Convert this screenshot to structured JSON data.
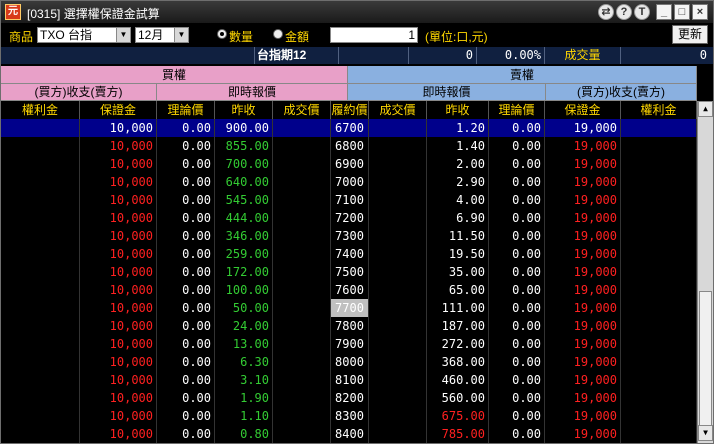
{
  "window": {
    "title": "[0315] 選擇權保證金試算",
    "icon_glyph": "元",
    "buttons": [
      "⇄",
      "?",
      "T",
      "_",
      "□",
      "×"
    ]
  },
  "toolbar": {
    "product_label": "商品",
    "product_value": "TXO 台指",
    "month_value": "12月",
    "radio_qty_label": "數量",
    "radio_amount_label": "金額",
    "quantity_value": "1",
    "unit_label": "(單位:口,元)",
    "refresh_label": "更新"
  },
  "info": {
    "name": "台指期12",
    "field1": "",
    "field2": "0",
    "change_pct": "0.00%",
    "volume_label": "成交量",
    "volume_value": "0"
  },
  "headers": {
    "call_group": "買權",
    "put_group": "賣權",
    "call_sub_left": "(買方)收支(賣方)",
    "call_sub_right": "即時報價",
    "put_sub_left": "即時報價",
    "put_sub_right": "(買方)收支(賣方)",
    "columns": [
      "權利金",
      "保證金",
      "理論價",
      "昨收",
      "成交價",
      "履約價",
      "成交價",
      "昨收",
      "理論價",
      "保證金",
      "權利金"
    ]
  },
  "colors": {
    "selected_row_bg": "#00008b",
    "atm_strike_bg": "#c0c0c0",
    "call_margin": "#ff2020",
    "call_prev_close": "#33cc33",
    "put_margin": "#ff2020",
    "white": "#ffffff",
    "yellow": "#ffd700",
    "red": "#ff2020"
  },
  "rows": [
    {
      "call_premium": "",
      "call_margin": "10,000",
      "call_theo": "0.00",
      "call_prev": "900.00",
      "call_last": "",
      "strike": "6700",
      "put_last": "",
      "put_prev": "1.20",
      "put_theo": "0.00",
      "put_margin": "19,000",
      "put_premium": "",
      "selected": true,
      "put_prev_color": "white"
    },
    {
      "call_premium": "",
      "call_margin": "10,000",
      "call_theo": "0.00",
      "call_prev": "855.00",
      "call_last": "",
      "strike": "6800",
      "put_last": "",
      "put_prev": "1.40",
      "put_theo": "0.00",
      "put_margin": "19,000",
      "put_premium": "",
      "put_prev_color": "white"
    },
    {
      "call_premium": "",
      "call_margin": "10,000",
      "call_theo": "0.00",
      "call_prev": "700.00",
      "call_last": "",
      "strike": "6900",
      "put_last": "",
      "put_prev": "2.00",
      "put_theo": "0.00",
      "put_margin": "19,000",
      "put_premium": "",
      "put_prev_color": "white"
    },
    {
      "call_premium": "",
      "call_margin": "10,000",
      "call_theo": "0.00",
      "call_prev": "640.00",
      "call_last": "",
      "strike": "7000",
      "put_last": "",
      "put_prev": "2.90",
      "put_theo": "0.00",
      "put_margin": "19,000",
      "put_premium": "",
      "put_prev_color": "white"
    },
    {
      "call_premium": "",
      "call_margin": "10,000",
      "call_theo": "0.00",
      "call_prev": "545.00",
      "call_last": "",
      "strike": "7100",
      "put_last": "",
      "put_prev": "4.00",
      "put_theo": "0.00",
      "put_margin": "19,000",
      "put_premium": "",
      "put_prev_color": "white"
    },
    {
      "call_premium": "",
      "call_margin": "10,000",
      "call_theo": "0.00",
      "call_prev": "444.00",
      "call_last": "",
      "strike": "7200",
      "put_last": "",
      "put_prev": "6.90",
      "put_theo": "0.00",
      "put_margin": "19,000",
      "put_premium": "",
      "put_prev_color": "white"
    },
    {
      "call_premium": "",
      "call_margin": "10,000",
      "call_theo": "0.00",
      "call_prev": "346.00",
      "call_last": "",
      "strike": "7300",
      "put_last": "",
      "put_prev": "11.50",
      "put_theo": "0.00",
      "put_margin": "19,000",
      "put_premium": "",
      "put_prev_color": "white"
    },
    {
      "call_premium": "",
      "call_margin": "10,000",
      "call_theo": "0.00",
      "call_prev": "259.00",
      "call_last": "",
      "strike": "7400",
      "put_last": "",
      "put_prev": "19.50",
      "put_theo": "0.00",
      "put_margin": "19,000",
      "put_premium": "",
      "put_prev_color": "white"
    },
    {
      "call_premium": "",
      "call_margin": "10,000",
      "call_theo": "0.00",
      "call_prev": "172.00",
      "call_last": "",
      "strike": "7500",
      "put_last": "",
      "put_prev": "35.00",
      "put_theo": "0.00",
      "put_margin": "19,000",
      "put_premium": "",
      "put_prev_color": "white"
    },
    {
      "call_premium": "",
      "call_margin": "10,000",
      "call_theo": "0.00",
      "call_prev": "100.00",
      "call_last": "",
      "strike": "7600",
      "put_last": "",
      "put_prev": "65.00",
      "put_theo": "0.00",
      "put_margin": "19,000",
      "put_premium": "",
      "put_prev_color": "white"
    },
    {
      "call_premium": "",
      "call_margin": "10,000",
      "call_theo": "0.00",
      "call_prev": "50.00",
      "call_last": "",
      "strike": "7700",
      "put_last": "",
      "put_prev": "111.00",
      "put_theo": "0.00",
      "put_margin": "19,000",
      "put_premium": "",
      "atm": true,
      "put_prev_color": "white"
    },
    {
      "call_premium": "",
      "call_margin": "10,000",
      "call_theo": "0.00",
      "call_prev": "24.00",
      "call_last": "",
      "strike": "7800",
      "put_last": "",
      "put_prev": "187.00",
      "put_theo": "0.00",
      "put_margin": "19,000",
      "put_premium": "",
      "put_prev_color": "white"
    },
    {
      "call_premium": "",
      "call_margin": "10,000",
      "call_theo": "0.00",
      "call_prev": "13.00",
      "call_last": "",
      "strike": "7900",
      "put_last": "",
      "put_prev": "272.00",
      "put_theo": "0.00",
      "put_margin": "19,000",
      "put_premium": "",
      "put_prev_color": "white"
    },
    {
      "call_premium": "",
      "call_margin": "10,000",
      "call_theo": "0.00",
      "call_prev": "6.30",
      "call_last": "",
      "strike": "8000",
      "put_last": "",
      "put_prev": "368.00",
      "put_theo": "0.00",
      "put_margin": "19,000",
      "put_premium": "",
      "put_prev_color": "white"
    },
    {
      "call_premium": "",
      "call_margin": "10,000",
      "call_theo": "0.00",
      "call_prev": "3.10",
      "call_last": "",
      "strike": "8100",
      "put_last": "",
      "put_prev": "460.00",
      "put_theo": "0.00",
      "put_margin": "19,000",
      "put_premium": "",
      "put_prev_color": "white"
    },
    {
      "call_premium": "",
      "call_margin": "10,000",
      "call_theo": "0.00",
      "call_prev": "1.90",
      "call_last": "",
      "strike": "8200",
      "put_last": "",
      "put_prev": "560.00",
      "put_theo": "0.00",
      "put_margin": "19,000",
      "put_premium": "",
      "put_prev_color": "white"
    },
    {
      "call_premium": "",
      "call_margin": "10,000",
      "call_theo": "0.00",
      "call_prev": "1.10",
      "call_last": "",
      "strike": "8300",
      "put_last": "",
      "put_prev": "675.00",
      "put_theo": "0.00",
      "put_margin": "19,000",
      "put_premium": "",
      "put_prev_color": "red"
    },
    {
      "call_premium": "",
      "call_margin": "10,000",
      "call_theo": "0.00",
      "call_prev": "0.80",
      "call_last": "",
      "strike": "8400",
      "put_last": "",
      "put_prev": "785.00",
      "put_theo": "0.00",
      "put_margin": "19,000",
      "put_premium": "",
      "put_prev_color": "red"
    }
  ],
  "scrollbar": {
    "up_glyph": "▲",
    "down_glyph": "▼"
  }
}
